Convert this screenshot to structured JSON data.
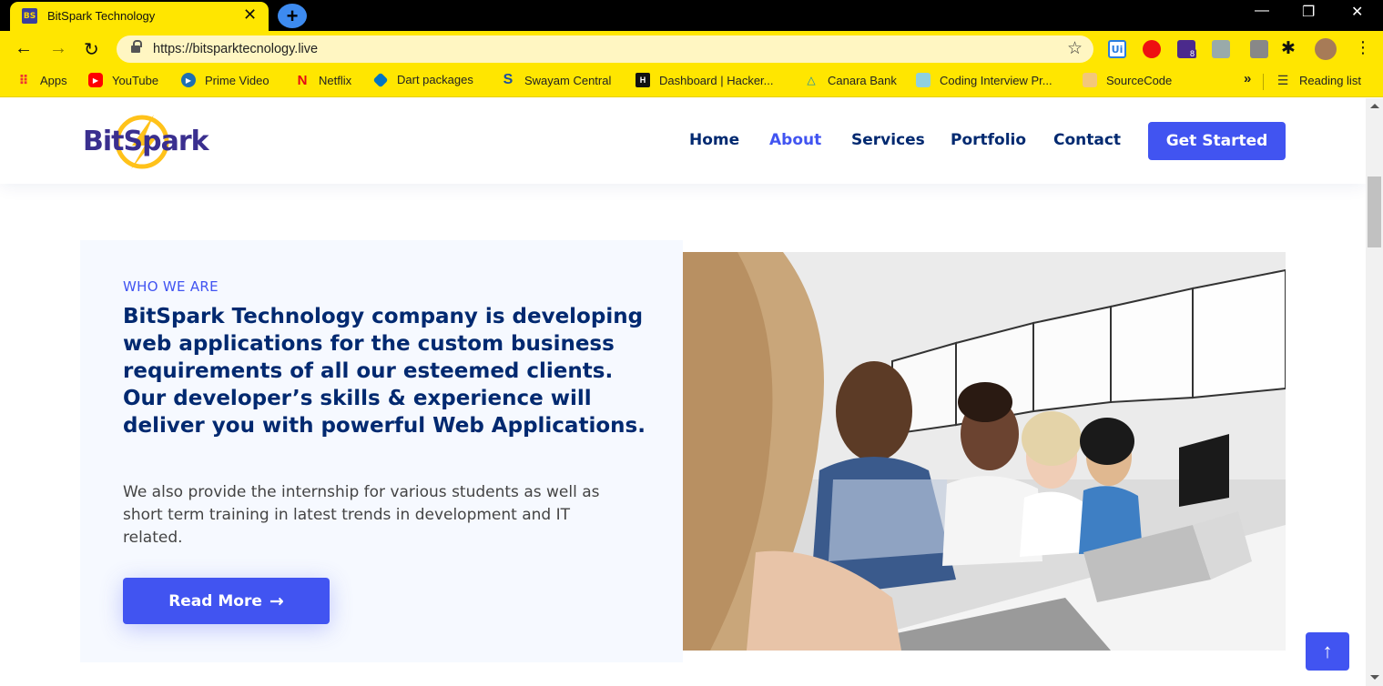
{
  "browser": {
    "tab_favicon": "BS",
    "tab_title": "BitSpark Technology",
    "url": "https://bitsparktecnology.live",
    "bookmarks": [
      {
        "label": "Apps",
        "icon": "apps-grid-icon"
      },
      {
        "label": "YouTube",
        "icon": "youtube-icon"
      },
      {
        "label": "Prime Video",
        "icon": "prime-video-icon"
      },
      {
        "label": "Netflix",
        "icon": "netflix-icon"
      },
      {
        "label": "Dart packages",
        "icon": "dart-icon"
      },
      {
        "label": "Swayam Central",
        "icon": "swayam-icon"
      },
      {
        "label": "Dashboard | Hacker...",
        "icon": "hackerrank-icon"
      },
      {
        "label": "Canara Bank",
        "icon": "canara-icon"
      },
      {
        "label": "Coding Interview Pr...",
        "icon": "coding-interview-icon"
      },
      {
        "label": "SourceCode",
        "icon": "sourcecode-icon"
      }
    ],
    "reading_list": "Reading list",
    "extension_badge": "8",
    "more_bookmarks": "»"
  },
  "site": {
    "logo": "BitSpark",
    "nav": [
      {
        "label": "Home",
        "active": false
      },
      {
        "label": "About",
        "active": true
      },
      {
        "label": "Services",
        "active": false
      },
      {
        "label": "Portfolio",
        "active": false
      },
      {
        "label": "Contact",
        "active": false
      }
    ],
    "cta_label": "Get Started"
  },
  "about": {
    "eyebrow": "WHO WE ARE",
    "headline": "BitSpark Technology company is developing web applications for the custom business requirements of all our esteemed clients. Our developer’s skills & experience will deliver you with powerful Web Applications.",
    "paragraph": "We also provide the internship for various students as well as short term training in latest trends in development and IT related.",
    "read_more": "Read More",
    "read_more_arrow": "→"
  },
  "colors": {
    "chrome_yellow": "#ffe600",
    "accent": "#4154f1",
    "heading": "#012970",
    "section_bg": "#f6f9ff"
  }
}
